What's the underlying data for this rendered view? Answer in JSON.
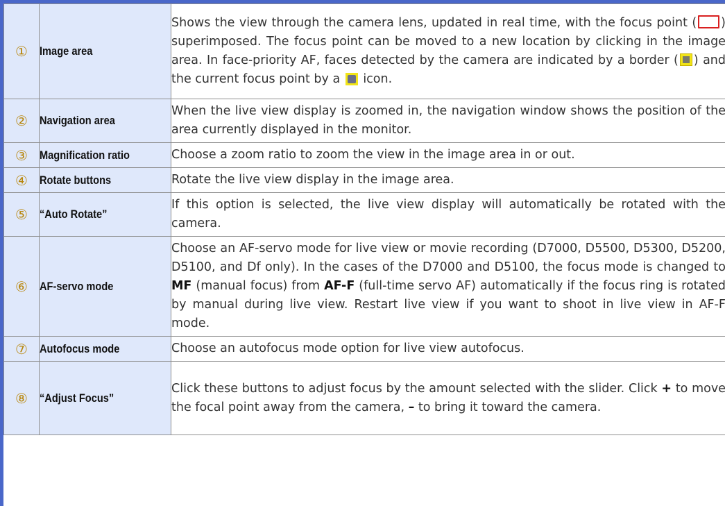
{
  "rows": [
    {
      "num": "①",
      "name": "Image area",
      "desc": {
        "p1": "Shows the view through the camera lens, updated in real time, with the focus point (",
        "p2": ") superimposed. The focus point can be moved to a new location by clicking in the image area. In face-priority AF, faces detected by the camera are indicated by a border (",
        "p3": ") and the current focus point by a ",
        "p4": " icon."
      }
    },
    {
      "num": "②",
      "name": "Navigation area",
      "desc": "When the live view display is zoomed in, the navigation window shows the position of the area currently displayed in the monitor."
    },
    {
      "num": "③",
      "name": "Magnification ratio",
      "desc": "Choose a zoom ratio to zoom the view in the image area in or out."
    },
    {
      "num": "④",
      "name": "Rotate buttons",
      "desc": "Rotate the live view display in the image area."
    },
    {
      "num": "⑤",
      "name": "“Auto Rotate”",
      "desc": "If this option is selected, the live view display will automatically be rotated with the camera."
    },
    {
      "num": "⑥",
      "name": "AF-servo mode",
      "desc": {
        "p1": "Choose an AF-servo mode for live view or movie recording (D7000, D5500, D5300, D5200, D5100, and Df only). In the cases of the D7000 and D5100, the focus mode is changed to ",
        "b1": "MF",
        "p2": " (manual focus) from ",
        "b2": "AF-F",
        "p3": " (full-time servo AF) automatically if the focus ring is rotated by manual during live view. Restart live view if you want to shoot in live view in AF-F mode."
      }
    },
    {
      "num": "⑦",
      "name": "Autofocus mode",
      "desc": "Choose an autofocus mode option for live view autofocus."
    },
    {
      "num": "⑧",
      "name": "“Adjust Focus”",
      "desc": {
        "p1": "Click these buttons to adjust focus by the amount selected with the slider. Click ",
        "b1": "+",
        "p2": " to move the focal point away from the camera, ",
        "b2": "–",
        "p3": " to bring it toward the camera."
      }
    }
  ],
  "icons": {
    "focus_frame": "red-focus-frame-icon",
    "face_border": "face-border-icon",
    "face_current": "current-focus-face-icon"
  },
  "colors": {
    "accent_blue": "#4a67c9",
    "label_cell_bg": "#dfe8fb",
    "number_gold": "#b8860b",
    "focus_red": "#d92020",
    "face_yellow": "#f1e418"
  }
}
